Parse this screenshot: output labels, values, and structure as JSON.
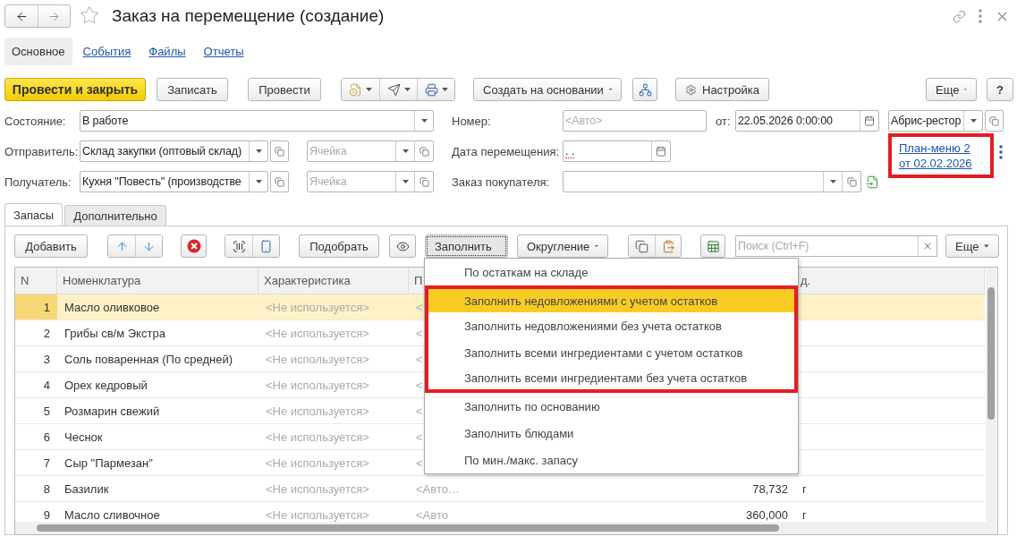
{
  "window": {
    "title": "Заказ на перемещение (создание)",
    "favorite": false
  },
  "sections": [
    {
      "label": "Основное",
      "selected": true
    },
    {
      "label": "События",
      "selected": false
    },
    {
      "label": "Файлы",
      "selected": false
    },
    {
      "label": "Отчеты",
      "selected": false
    }
  ],
  "commands": {
    "primary": "Провести и закрыть",
    "write": "Записать",
    "post": "Провести",
    "create_based": "Создать на основании",
    "settings": "Настройка",
    "more": "Еще",
    "help": "?"
  },
  "header": {
    "state_label": "Состояние:",
    "state_value": "В работе",
    "number_label": "Номер:",
    "number_placeholder": "<Авто>",
    "date_label": "от:",
    "date_value": "22.05.2026  0:00:00",
    "organization": "Абрис-рестор",
    "sender_label": "Отправитель:",
    "sender_value": "Склад закупки (оптовый склад)",
    "sender_cell_placeholder": "Ячейка",
    "move_date_label": "Дата перемещения:",
    "move_date_value": ". .",
    "move_date_required": true,
    "receiver_label": "Получатель:",
    "receiver_value": "Кухня \"Повесть\" (производстве",
    "receiver_cell_placeholder": "Ячейка",
    "customer_order_label": "Заказ покупателя:",
    "plan_link": {
      "text": "План-меню 2 от 02.02.2026",
      "annotated": true
    }
  },
  "tabs": [
    {
      "label": "Запасы",
      "selected": true
    },
    {
      "label": "Дополнительно",
      "selected": false
    }
  ],
  "table_toolbar": {
    "add": "Добавить",
    "pick": "Подобрать",
    "fill": "Заполнить",
    "fill_open": true,
    "rounding": "Округление",
    "search_placeholder": "Поиск (Ctrl+F)",
    "more": "Еще"
  },
  "fill_menu": [
    {
      "label": "По остаткам на складе",
      "selected": false,
      "annotated": false
    },
    {
      "label": "Заполнить недовложениями с учетом остатков",
      "selected": true,
      "annotated": true
    },
    {
      "label": "Заполнить недовложениями без учета остатков",
      "selected": false,
      "annotated": true
    },
    {
      "label": "Заполнить всеми ингредиентами с учетом остатков",
      "selected": false,
      "annotated": true
    },
    {
      "label": "Заполнить всеми ингредиентами без учета остатков",
      "selected": false,
      "annotated": true
    },
    {
      "label": "Заполнить по основанию",
      "selected": false,
      "annotated": false
    },
    {
      "label": "Заполнить блюдами",
      "selected": false,
      "annotated": false
    },
    {
      "label": "По мин./макс. запасу",
      "selected": false,
      "annotated": false
    }
  ],
  "table": {
    "columns": [
      "N",
      "Номенклатура",
      "Характеристика",
      "П",
      "д."
    ],
    "rows": [
      {
        "n": "1",
        "name": "Масло оливковое",
        "characteristic": "<Не используется>",
        "column_4": "<",
        "selected": true
      },
      {
        "n": "2",
        "name": "Грибы св/м Экстра",
        "characteristic": "<Не используется>",
        "column_4": "<",
        "selected": false
      },
      {
        "n": "3",
        "name": "Соль поваренная (По средней)",
        "characteristic": "<Не используется>",
        "column_4": "<",
        "selected": false
      },
      {
        "n": "4",
        "name": "Орех кедровый",
        "characteristic": "<Не используется>",
        "column_4": "<",
        "selected": false
      },
      {
        "n": "5",
        "name": "Розмарин свежий",
        "characteristic": "<Не используется>",
        "column_4": "<",
        "selected": false
      },
      {
        "n": "6",
        "name": "Чеснок",
        "characteristic": "<Не используется>",
        "column_4": "<",
        "selected": false
      },
      {
        "n": "7",
        "name": "Сыр \"Пармезан\"",
        "characteristic": "<Не используется>",
        "column_4": "<",
        "selected": false
      },
      {
        "n": "8",
        "name": "Базилик",
        "characteristic": "<Не используется>",
        "column_4": "<Авто…",
        "quantity": "78,732",
        "unit": "г",
        "selected": false
      },
      {
        "n": "9",
        "name": "Масло сливочное",
        "characteristic": "<Не используется>",
        "column_4": "<Авто",
        "quantity": "360,000",
        "unit": "г",
        "selected": false
      }
    ]
  }
}
